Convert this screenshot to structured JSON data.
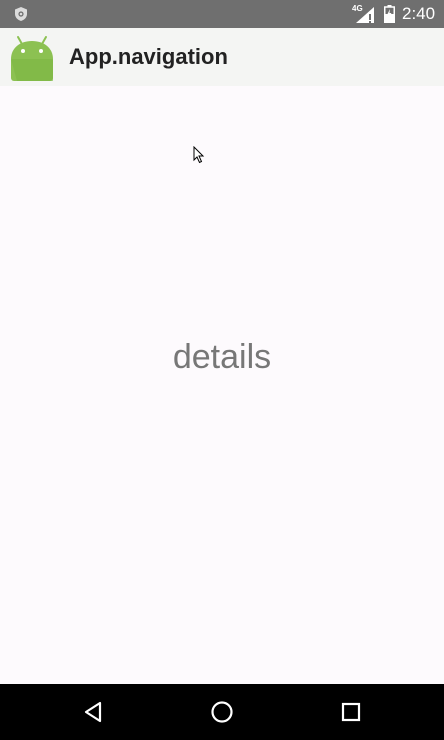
{
  "status_bar": {
    "left_icon": "shield-icon",
    "network_label": "4G",
    "network_icon": "signal-icon",
    "battery_icon": "battery-charging-icon",
    "time": "2:40",
    "background": "#6f6f6f"
  },
  "app_bar": {
    "logo_icon": "android-icon",
    "title": "App.navigation",
    "background": "#f4f5f3"
  },
  "content": {
    "text": "details",
    "background": "#fdfafd"
  },
  "nav_bar": {
    "back_icon": "back-triangle-icon",
    "home_icon": "home-circle-icon",
    "recents_icon": "recents-square-icon",
    "background": "#000000"
  }
}
